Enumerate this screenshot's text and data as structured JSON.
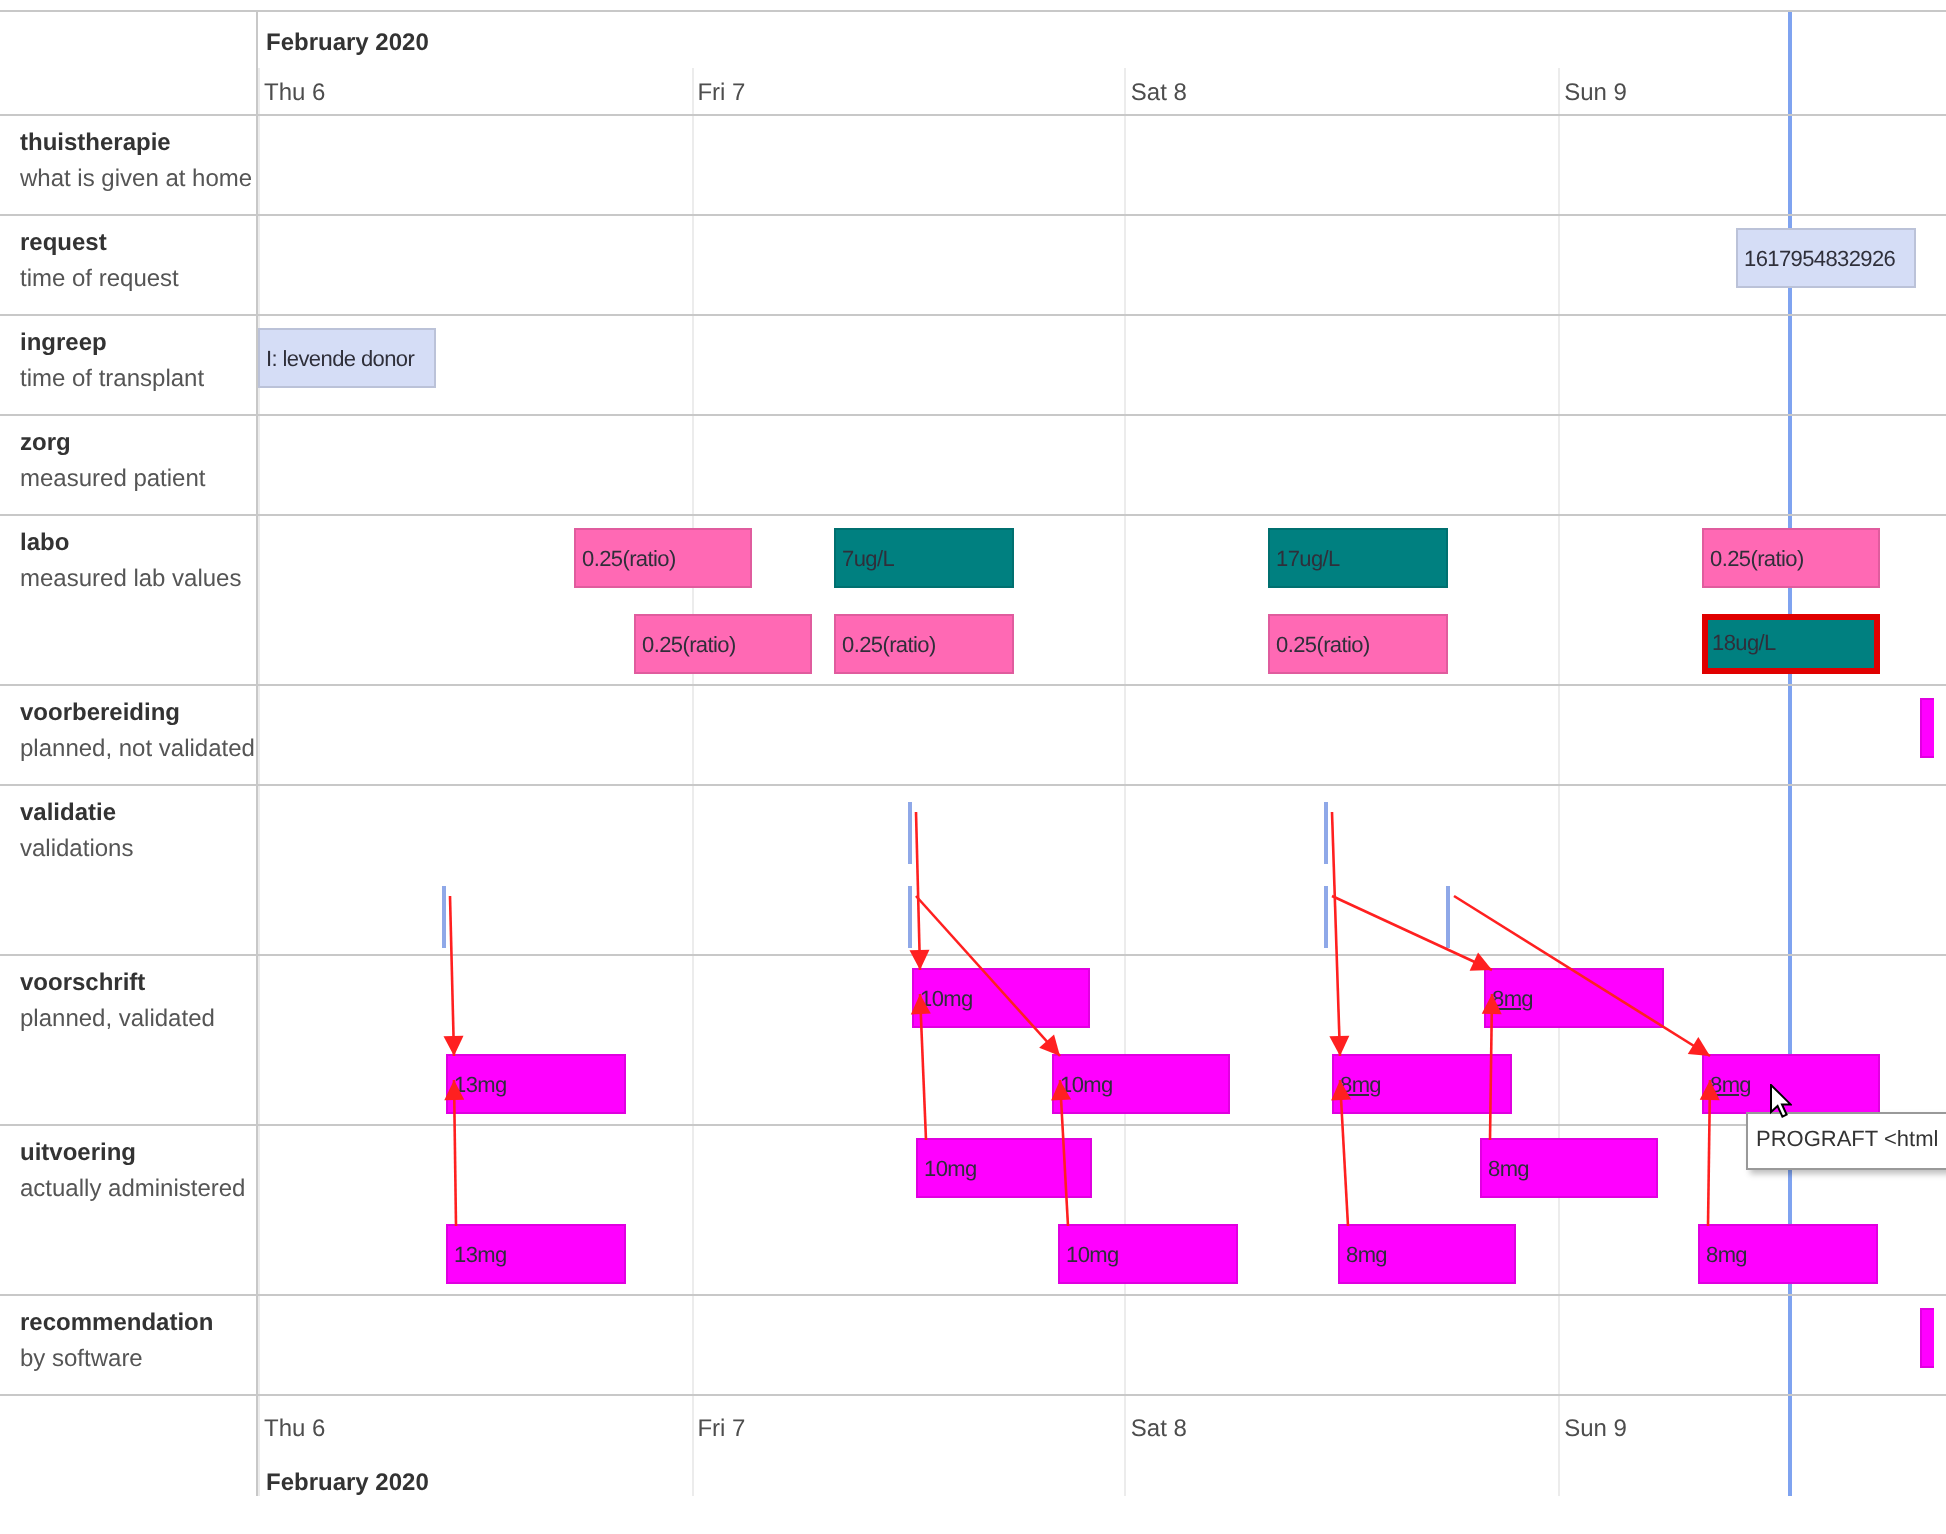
{
  "top_axis": {
    "month": "February 2020",
    "days": [
      {
        "label": "Thu 6"
      },
      {
        "label": "Fri 7"
      },
      {
        "label": "Sat 8"
      },
      {
        "label": "Sun 9"
      }
    ]
  },
  "groups": [
    {
      "title": "thuistherapie",
      "subtitle": "what is given at home"
    },
    {
      "title": "request",
      "subtitle": "time of request",
      "items": [
        {
          "kind": "range",
          "text": "1617954832926",
          "color": "#d5ddf6",
          "selected": false
        }
      ]
    },
    {
      "title": "ingreep",
      "subtitle": "time of transplant",
      "items": [
        {
          "kind": "range",
          "text": "I: levende donor",
          "color": "#d5ddf6",
          "selected": false
        }
      ]
    },
    {
      "title": "zorg",
      "subtitle": "measured patient"
    },
    {
      "title": "labo",
      "subtitle": "measured lab values",
      "items": [
        {
          "kind": "range",
          "text": "0.25(ratio)",
          "color": "#ff69b4",
          "selected": false
        },
        {
          "kind": "range",
          "text": "0.25(ratio)",
          "color": "#ff69b4",
          "selected": false
        },
        {
          "kind": "range",
          "text": "7ug/L",
          "color": "#008080",
          "selected": false
        },
        {
          "kind": "range",
          "text": "0.25(ratio)",
          "color": "#ff69b4",
          "selected": false
        },
        {
          "kind": "range",
          "text": "17ug/L",
          "color": "#008080",
          "selected": false
        },
        {
          "kind": "range",
          "text": "0.25(ratio)",
          "color": "#ff69b4",
          "selected": false
        },
        {
          "kind": "range",
          "text": "0.25(ratio)",
          "color": "#ff69b4",
          "selected": false
        },
        {
          "kind": "range",
          "text": "18ug/L",
          "color": "#008080",
          "selected": true
        }
      ]
    },
    {
      "title": "voorbereiding",
      "subtitle": "planned, not validated",
      "items": [
        {
          "kind": "range",
          "color": "#ff00ff",
          "selected": false
        }
      ]
    },
    {
      "title": "validatie",
      "subtitle": "validations",
      "items": [
        {
          "kind": "point",
          "color": "#8fa8e8"
        },
        {
          "kind": "point",
          "color": "#8fa8e8"
        },
        {
          "kind": "point",
          "color": "#8fa8e8"
        },
        {
          "kind": "point",
          "color": "#8fa8e8"
        },
        {
          "kind": "point",
          "color": "#8fa8e8"
        },
        {
          "kind": "point",
          "color": "#8fa8e8"
        }
      ]
    },
    {
      "title": "voorschrift",
      "subtitle": "planned, validated",
      "items": [
        {
          "kind": "range",
          "text": "13mg",
          "color": "#ff00ff",
          "selected": false,
          "underlined": false
        },
        {
          "kind": "range",
          "text": "10mg",
          "color": "#ff00ff",
          "selected": false,
          "underlined": false
        },
        {
          "kind": "range",
          "text": "10mg",
          "color": "#ff00ff",
          "selected": false,
          "underlined": false
        },
        {
          "kind": "range",
          "text": "8mg",
          "color": "#ff00ff",
          "selected": false,
          "underlined": true
        },
        {
          "kind": "range",
          "text": "8mg",
          "color": "#ff00ff",
          "selected": false,
          "underlined": true
        },
        {
          "kind": "range",
          "text": "8mg",
          "color": "#ff00ff",
          "selected": false,
          "underlined": true,
          "tooltip": "PROGRAFT <html"
        }
      ]
    },
    {
      "title": "uitvoering",
      "subtitle": "actually administered",
      "items": [
        {
          "kind": "range",
          "text": "13mg",
          "color": "#ff00ff",
          "selected": false
        },
        {
          "kind": "range",
          "text": "10mg",
          "color": "#ff00ff",
          "selected": false
        },
        {
          "kind": "range",
          "text": "10mg",
          "color": "#ff00ff",
          "selected": false
        },
        {
          "kind": "range",
          "text": "8mg",
          "color": "#ff00ff",
          "selected": false
        },
        {
          "kind": "range",
          "text": "8mg",
          "color": "#ff00ff",
          "selected": false
        },
        {
          "kind": "range",
          "text": "8mg",
          "color": "#ff00ff",
          "selected": false
        }
      ]
    },
    {
      "title": "recommendation",
      "subtitle": "by software",
      "items": [
        {
          "kind": "range",
          "color": "#ff00ff",
          "selected": false
        }
      ]
    }
  ],
  "bottom_axis": {
    "month": "February 2020",
    "days": [
      {
        "label": "Thu 6"
      },
      {
        "label": "Fri 7"
      },
      {
        "label": "Sat 8"
      },
      {
        "label": "Sun 9"
      }
    ]
  }
}
